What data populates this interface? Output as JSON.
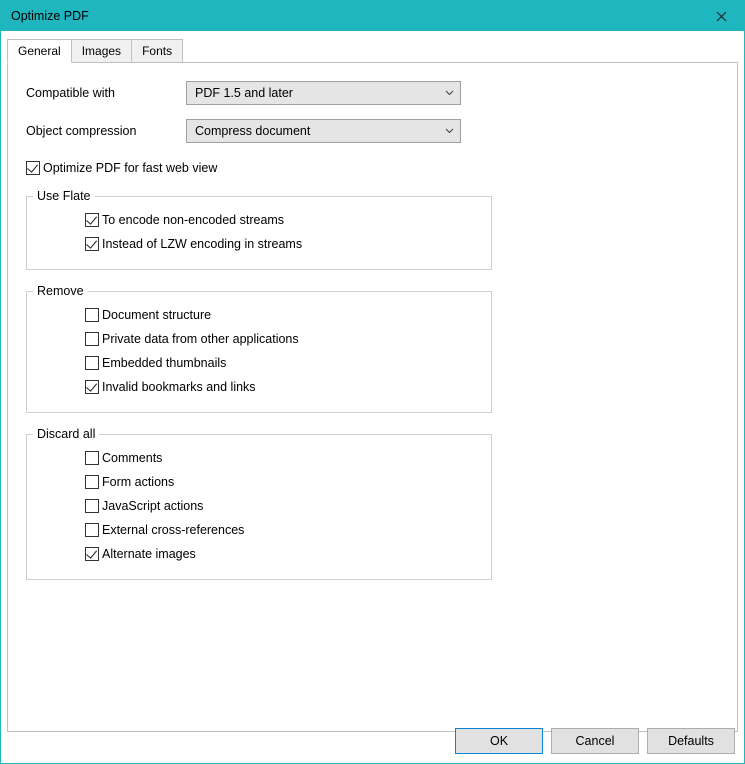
{
  "title": "Optimize PDF",
  "tabs": {
    "general": "General",
    "images": "Images",
    "fonts": "Fonts"
  },
  "labels": {
    "compatible": "Compatible with",
    "objcomp": "Object compression"
  },
  "selects": {
    "compatible": "PDF 1.5 and later",
    "objcomp": "Compress document"
  },
  "optFastWeb": "Optimize PDF for fast web view",
  "groups": {
    "flate": {
      "legend": "Use Flate",
      "encode": "To encode non-encoded streams",
      "lzw": "Instead of LZW encoding in streams"
    },
    "remove": {
      "legend": "Remove",
      "docstruct": "Document structure",
      "privdata": "Private data from other applications",
      "thumbs": "Embedded thumbnails",
      "bookmarks": "Invalid bookmarks and links"
    },
    "discard": {
      "legend": "Discard all",
      "comments": "Comments",
      "formactions": "Form actions",
      "jsactions": "JavaScript actions",
      "xrefs": "External cross-references",
      "altimg": "Alternate images"
    }
  },
  "buttons": {
    "ok": "OK",
    "cancel": "Cancel",
    "defaults": "Defaults"
  }
}
